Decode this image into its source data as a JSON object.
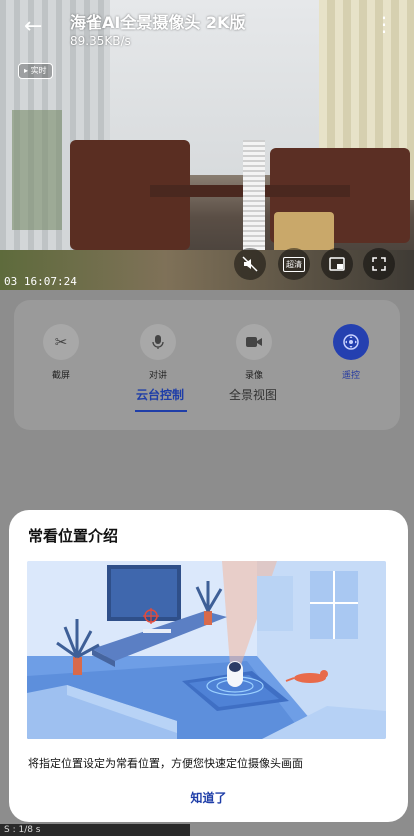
{
  "header": {
    "back_icon": "arrow-left-icon",
    "title": "海雀AI全景摄像头 2K版",
    "speed": "89.35KB/s",
    "more_icon": "more-vertical-icon"
  },
  "video": {
    "live_badge": "实时",
    "timestamp": "03 16:07:24",
    "buttons": [
      {
        "icon": "mute-icon",
        "glyph": "🔇"
      },
      {
        "icon": "hd-icon",
        "label": "超清"
      },
      {
        "icon": "picture-in-picture-icon",
        "glyph": "⧉"
      },
      {
        "icon": "fullscreen-icon",
        "glyph": "⤢"
      }
    ]
  },
  "controls": [
    {
      "label": "截屏",
      "icon": "screenshot-icon",
      "glyph": "✂",
      "active": false
    },
    {
      "label": "对讲",
      "icon": "microphone-icon",
      "glyph": "🎙",
      "active": false
    },
    {
      "label": "录像",
      "icon": "video-record-icon",
      "glyph": "▶",
      "active": false
    },
    {
      "label": "遥控",
      "icon": "remote-control-icon",
      "glyph": "✥",
      "active": true
    }
  ],
  "tabs": [
    {
      "label": "云台控制",
      "active": true
    },
    {
      "label": "全景视图",
      "active": false
    }
  ],
  "modal": {
    "title": "常看位置介绍",
    "description": "将指定位置设定为常看位置，方便您快速定位摄像头画面",
    "ok_button": "知道了"
  },
  "status_strip": "S : 1/8 s",
  "colors": {
    "accent": "#1f3ea8",
    "active_control": "#2440b0",
    "modal_bg": "#ffffff",
    "dim_overlay": "#8d8d8d"
  }
}
